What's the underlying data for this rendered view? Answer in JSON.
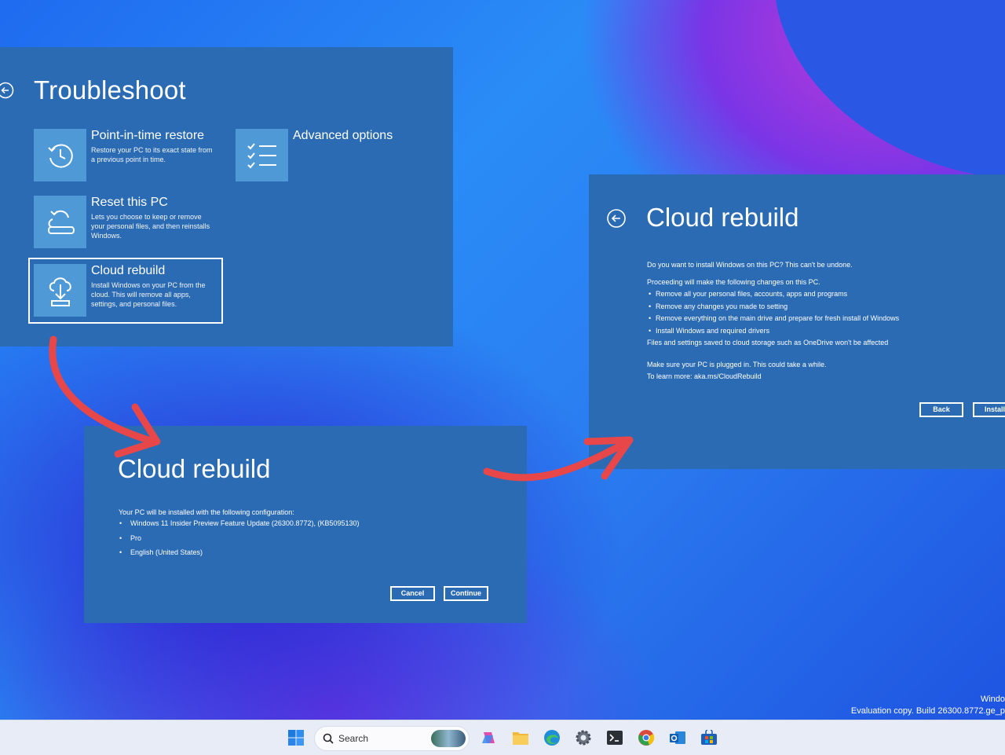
{
  "troubleshoot": {
    "title": "Troubleshoot",
    "tiles": [
      {
        "name": "Point-in-time restore",
        "desc": "Restore your PC to its exact state from a previous point in time.",
        "icon": "restore-clock-icon"
      },
      {
        "name": "Advanced options",
        "desc": "",
        "icon": "checklist-icon"
      },
      {
        "name": "Reset this PC",
        "desc": "Lets you choose to keep or remove your personal files, and then reinstalls Windows.",
        "icon": "reset-pc-icon"
      },
      {
        "name": "Cloud rebuild",
        "desc": "Install Windows on your PC from the cloud. This will remove all apps, settings, and personal files.",
        "icon": "cloud-download-icon"
      }
    ]
  },
  "config_panel": {
    "title": "Cloud rebuild",
    "intro": "Your PC will be installed with the following configuration:",
    "items": [
      "Windows 11 Insider Preview Feature Update (26300.8772), (KB5095130)",
      "Pro",
      "English (United States)"
    ],
    "cancel_label": "Cancel",
    "continue_label": "Continue"
  },
  "confirm_panel": {
    "title": "Cloud rebuild",
    "question": "Do you want to install Windows on this PC? This can't be undone.",
    "changes_intro": "Proceeding will make the following changes on this PC.",
    "changes": [
      "Remove all your personal files, accounts, apps and programs",
      "Remove any changes you made to setting",
      "Remove everything on the main drive and prepare for fresh install of Windows",
      "Install Windows and required drivers"
    ],
    "cloud_note": "Files and settings saved to cloud storage such as OneDrive won't be affected",
    "plug_note": "Make sure your PC is plugged in. This could take a while.",
    "learn_more": "To learn more: aka.ms/CloudRebuild",
    "back_label": "Back",
    "install_label": "Install"
  },
  "watermark": {
    "line1": "Windo",
    "line2": "Evaluation copy. Build 26300.8772.ge_p"
  },
  "taskbar": {
    "search_placeholder": "Search",
    "icons": [
      "windows-start-icon",
      "copilot-icon",
      "file-explorer-icon",
      "edge-icon",
      "settings-icon",
      "terminal-icon",
      "chrome-icon",
      "outlook-icon",
      "store-icon"
    ]
  },
  "colors": {
    "panel": "#2b6bb3",
    "tile_icon": "#4f9ad6",
    "arrow": "#e8474a"
  }
}
